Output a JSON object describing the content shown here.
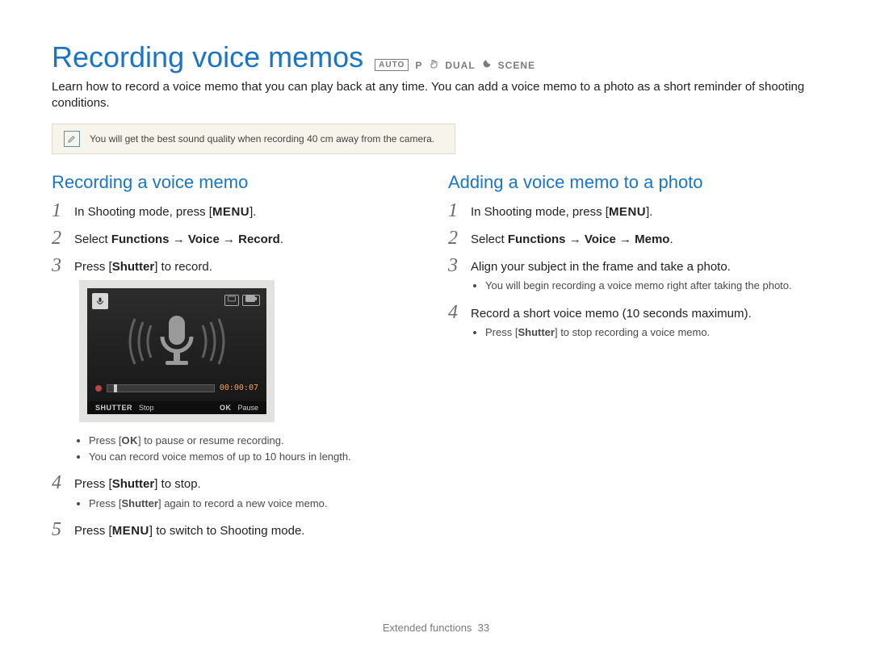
{
  "title": "Recording voice memos",
  "modes": {
    "auto": "AUTO",
    "p": "P",
    "dual": "DUAL",
    "scene": "SCENE"
  },
  "intro": "Learn how to record a voice memo that you can play back at any time. You can add a voice memo to a photo as a short reminder of shooting conditions.",
  "tip": "You will get the best sound quality when recording 40 cm away from the camera.",
  "left": {
    "heading": "Recording a voice memo",
    "s1_a": "In Shooting mode, press [",
    "s1_k": "MENU",
    "s1_b": "].",
    "s2_a": "Select ",
    "s2_f": "Functions",
    "s2_arr1": " → ",
    "s2_v": "Voice",
    "s2_arr2": " → ",
    "s2_r": "Record",
    "s2_dot": ".",
    "s3_a": "Press [",
    "s3_k": "Shutter",
    "s3_b": "] to record.",
    "sub_ok_a": "Press [",
    "sub_ok_k": "OK",
    "sub_ok_b": "] to pause or resume recording.",
    "sub_len": "You can record voice memos of up to 10 hours in length.",
    "s4_a": "Press [",
    "s4_k": "Shutter",
    "s4_b": "] to stop.",
    "sub_again_a": "Press [",
    "sub_again_k": "Shutter",
    "sub_again_b": "] again to record a new voice memo.",
    "s5_a": "Press [",
    "s5_k": "MENU",
    "s5_b": "] to switch to Shooting mode."
  },
  "right": {
    "heading": "Adding a voice memo to a photo",
    "s1_a": "In Shooting mode, press [",
    "s1_k": "MENU",
    "s1_b": "].",
    "s2_a": "Select ",
    "s2_f": "Functions",
    "s2_arr1": " → ",
    "s2_v": "Voice",
    "s2_arr2": " → ",
    "s2_m": "Memo",
    "s2_dot": ".",
    "s3": "Align your subject in the frame and take a photo.",
    "sub_after": "You will begin recording a voice memo right after taking the photo.",
    "s4": "Record a short voice memo (10 seconds maximum).",
    "sub_stop_a": "Press [",
    "sub_stop_k": "Shutter",
    "sub_stop_b": "] to stop recording a voice memo."
  },
  "screen": {
    "time": "00:00:07",
    "stop_lbl": "SHUTTER",
    "stop_txt": "Stop",
    "ok_lbl": "OK",
    "ok_txt": "Pause"
  },
  "footer": {
    "section": "Extended functions",
    "page": "33"
  }
}
